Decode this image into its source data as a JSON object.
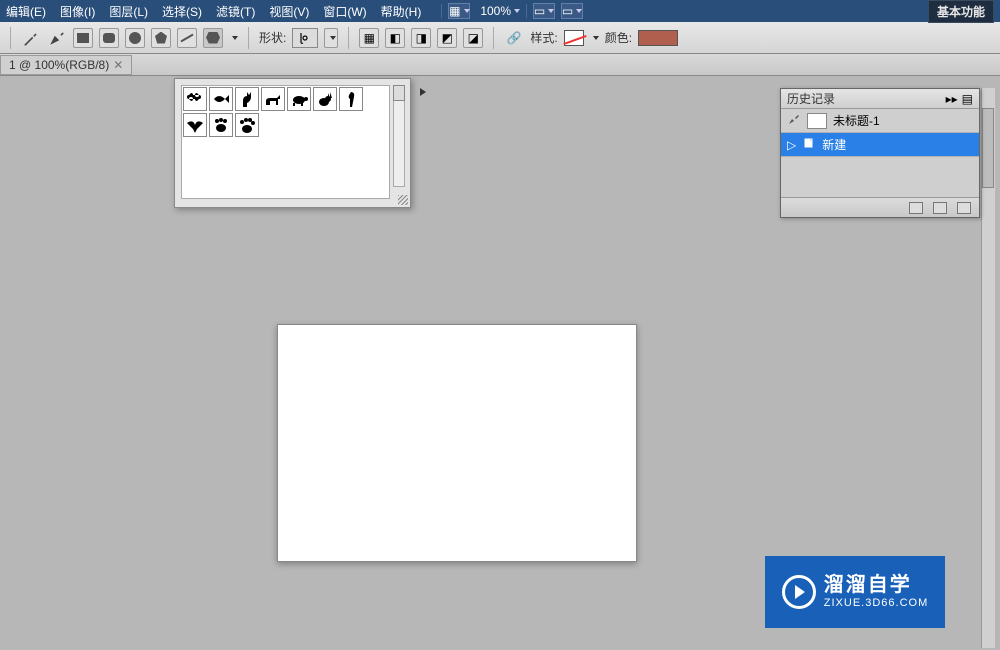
{
  "menubar": {
    "items": [
      "编辑(E)",
      "图像(I)",
      "图层(L)",
      "选择(S)",
      "滤镜(T)",
      "视图(V)",
      "窗口(W)",
      "帮助(H)"
    ],
    "zoom": "100%",
    "workspace_btn": "基本功能"
  },
  "optionsbar": {
    "shape_label": "形状:",
    "style_label": "样式:",
    "color_label": "颜色:",
    "color_value": "#b05e4e"
  },
  "tab": {
    "title": "1 @ 100%(RGB/8)",
    "close": "✕"
  },
  "shape_dropdown": {
    "shapes": [
      "bone",
      "fish",
      "cat",
      "dog",
      "turtle",
      "rabbit",
      "parrot",
      "bird",
      "paw1",
      "paw2"
    ]
  },
  "history_panel": {
    "title": "历史记录",
    "doc_row": "未标题-1",
    "step_row": "新建"
  },
  "watermark": {
    "line1": "溜溜自学",
    "line2": "ZIXUE.3D66.COM"
  }
}
